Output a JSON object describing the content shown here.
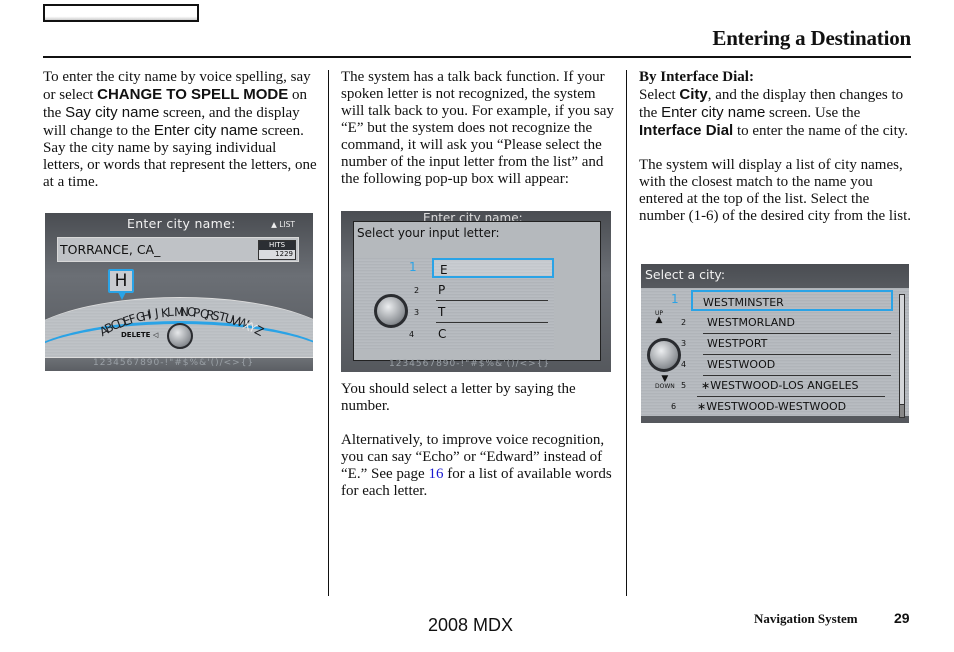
{
  "header": {
    "title": "Entering a Destination"
  },
  "column1": {
    "p1_a": "To enter the city name by voice spelling, say or select ",
    "p1_cmd": "CHANGE TO SPELL MODE",
    "p1_b": " on the ",
    "p1_screen1": "Say city name",
    "p1_c": " screen, and the display will change to the ",
    "p1_screen2": "Enter city name",
    "p1_d": " screen.",
    "p2": "Say the city name by saying individual letters, or words that represent the letters, one at a time."
  },
  "screen1": {
    "title": "Enter city name:",
    "list_hint": "LIST",
    "input_value": "TORRANCE, CA_",
    "hits_label": "HITS",
    "hits_value": "1229",
    "selected_letter": "H",
    "alphabet": [
      "A",
      "B",
      "C",
      "D",
      "E",
      "F",
      "G",
      "H",
      "I",
      "J",
      "K",
      "L",
      "M",
      "N",
      "O",
      "P",
      "Q",
      "R",
      "S",
      "T",
      "U",
      "V",
      "W",
      "X",
      "Y",
      "Z"
    ],
    "delete_label": "DELETE",
    "bottom_chars": "1234567890-!\"#$%&'()/<>{}"
  },
  "column2": {
    "p1_a": "The system has a talk back function. If your spoken letter is not recognized, the system will talk back to you. For example, if you say “E” but the system does not recognize the command, it will ask you “Please select the number of the input letter from the list” and the following pop-up box will appear:",
    "p2": "You should select a letter by saying the number.",
    "p3_a": "Alternatively, to improve voice recognition, you can say “Echo” or “Edward” instead of “E.” See page ",
    "p3_link": "16",
    "p3_b": " for a list of available words for each letter."
  },
  "screen2": {
    "bg_title": "Enter city name:",
    "popup_title": "Select your input letter:",
    "items": [
      {
        "num": "1",
        "label": "E",
        "selected": true
      },
      {
        "num": "2",
        "label": "P",
        "selected": false
      },
      {
        "num": "3",
        "label": "T",
        "selected": false
      },
      {
        "num": "4",
        "label": "C",
        "selected": false
      }
    ],
    "bottom_chars": "1234567890-!\"#$%&'()/<>{}"
  },
  "column3": {
    "heading": "By Interface Dial:",
    "p1_a": "Select ",
    "p1_city": "City",
    "p1_b": ", and the display then changes to the ",
    "p1_screen": "Enter city name",
    "p1_c": " screen. Use the ",
    "p1_dial": "Interface Dial",
    "p1_d": " to enter the name of the city.",
    "p2": "The system will display a list of city names, with the closest match to the name you entered at the top of the list. Select the number (1-6) of the desired city from the list."
  },
  "screen3": {
    "title": "Select a city:",
    "up_label": "UP",
    "down_label": "DOWN",
    "items": [
      {
        "num": "1",
        "label": "WESTMINSTER",
        "selected": true
      },
      {
        "num": "2",
        "label": "WESTMORLAND",
        "selected": false
      },
      {
        "num": "3",
        "label": "WESTPORT",
        "selected": false
      },
      {
        "num": "4",
        "label": "WESTWOOD",
        "selected": false
      },
      {
        "num": "5",
        "label": "∗WESTWOOD-LOS ANGELES",
        "selected": false
      },
      {
        "num": "6",
        "label": "∗WESTWOOD-WESTWOOD",
        "selected": false
      }
    ]
  },
  "footer": {
    "model": "2008  MDX",
    "section": "Navigation System",
    "page": "29"
  },
  "colors": {
    "accent_blue": "#2aa3e6",
    "link_blue": "#1a1ad0"
  }
}
